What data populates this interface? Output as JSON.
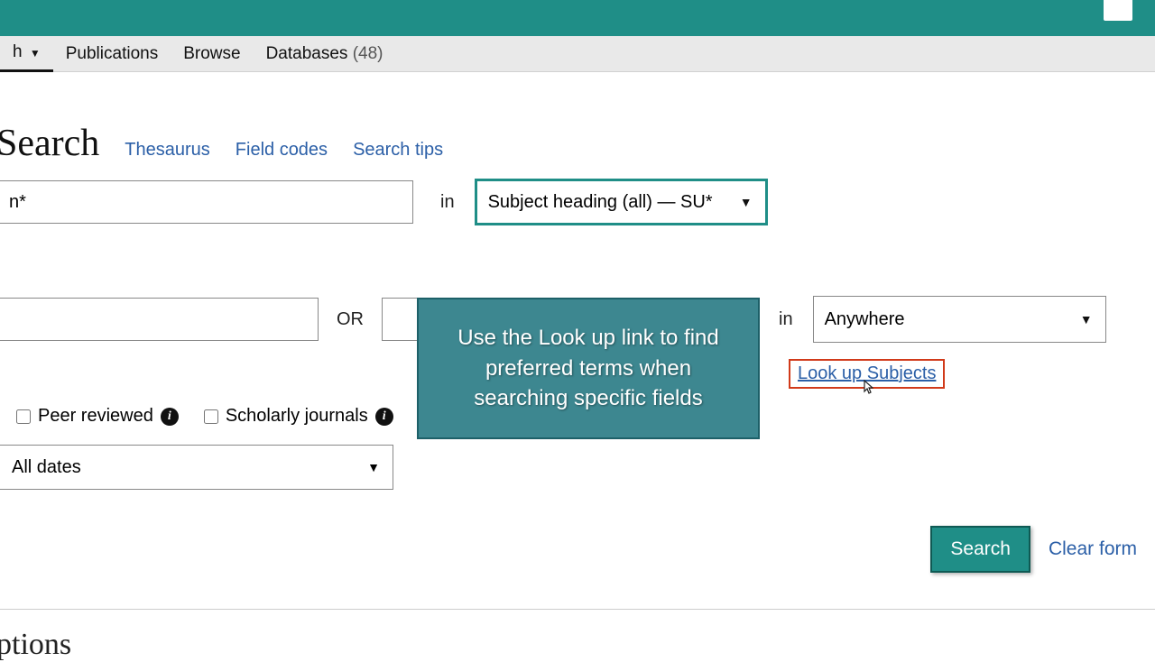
{
  "nav": {
    "search_dropdown": "h",
    "publications": "Publications",
    "browse": "Browse",
    "databases": "Databases",
    "databases_count": "(48)"
  },
  "page": {
    "title": "Search",
    "options_heading": "ptions"
  },
  "title_links": {
    "thesaurus": "Thesaurus",
    "field_codes": "Field codes",
    "search_tips": "Search tips"
  },
  "tooltip": "Use the Look up link to find preferred terms when searching specific fields",
  "row1": {
    "input_value": "n*",
    "in_label": "in",
    "field_value": "Subject heading (all) — SU*",
    "lookup_label": "Look up Subjects"
  },
  "row2": {
    "or_label": "OR",
    "in_label": "in",
    "field_value": "Anywhere"
  },
  "limits": {
    "peer_reviewed": "Peer reviewed",
    "scholarly": "Scholarly journals",
    "date_value": "All dates"
  },
  "actions": {
    "search": "Search",
    "clear": "Clear form"
  }
}
